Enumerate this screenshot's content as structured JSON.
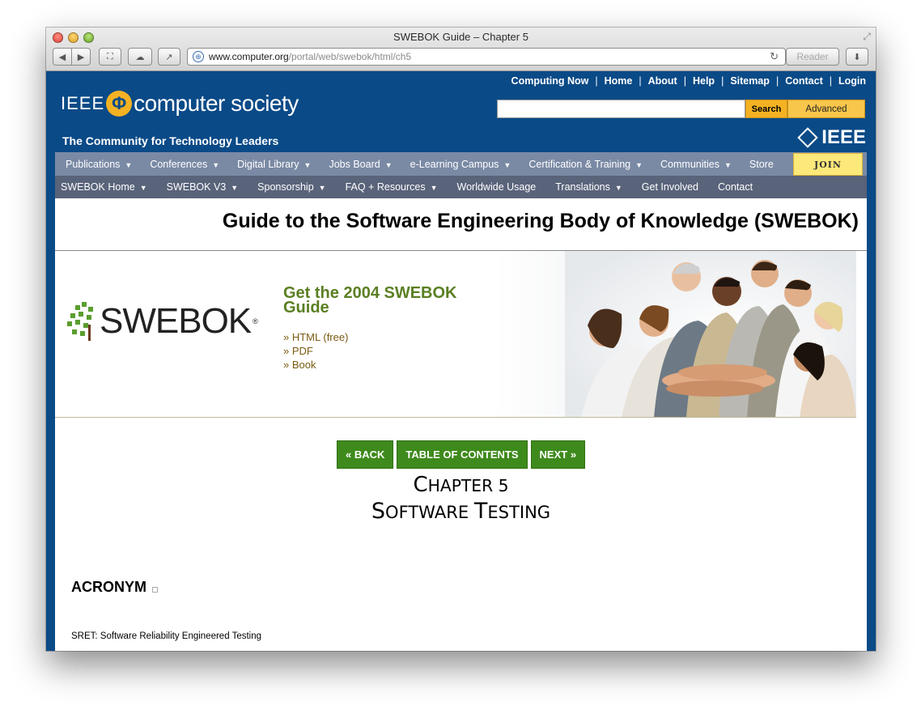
{
  "window": {
    "title": "SWEBOK Guide – Chapter 5",
    "url_host": "www.computer.org",
    "url_path": "/portal/web/swebok/html/ch5",
    "reader_label": "Reader"
  },
  "header": {
    "top_links": [
      "Computing Now",
      "Home",
      "About",
      "Help",
      "Sitemap",
      "Contact",
      "Login"
    ],
    "logo_ieee": "IEEE",
    "logo_phi": "Φ",
    "logo_cs": "computer society",
    "tagline": "The Community for Technology Leaders",
    "search_label": "Search",
    "advanced_label": "Advanced",
    "ieee_mark": "IEEE",
    "brand_color": "#0a4a87",
    "accent_color": "#f4b223"
  },
  "nav1": {
    "items": [
      "Publications",
      "Conferences",
      "Digital Library",
      "Jobs Board",
      "e-Learning Campus",
      "Certification & Training",
      "Communities",
      "Store"
    ],
    "join_label": "JOIN"
  },
  "nav2": {
    "items": [
      "SWEBOK Home",
      "SWEBOK V3",
      "Sponsorship",
      "FAQ + Resources",
      "Worldwide Usage",
      "Translations",
      "Get Involved",
      "Contact"
    ]
  },
  "main": {
    "title": "Guide to the Software Engineering Body of Knowledge (SWEBOK)",
    "banner": {
      "logo_text": "SWEBOK",
      "logo_reg": "®",
      "get_title": "Get the 2004 SWEBOK Guide",
      "links": [
        "» HTML (free)",
        "» PDF",
        "» Book"
      ]
    },
    "buttons": {
      "back": "« BACK",
      "toc": "TABLE OF CONTENTS",
      "next": "NEXT »"
    },
    "chapter_line1_cap": "C",
    "chapter_line1_rest": "HAPTER 5",
    "chapter_line2_cap1": "S",
    "chapter_line2_rest1": "OFTWARE ",
    "chapter_line2_cap2": "T",
    "chapter_line2_rest2": "ESTING",
    "acronym_heading": "ACRONYM",
    "acronym_item": "SRET: Software Reliability Engineered Testing"
  }
}
